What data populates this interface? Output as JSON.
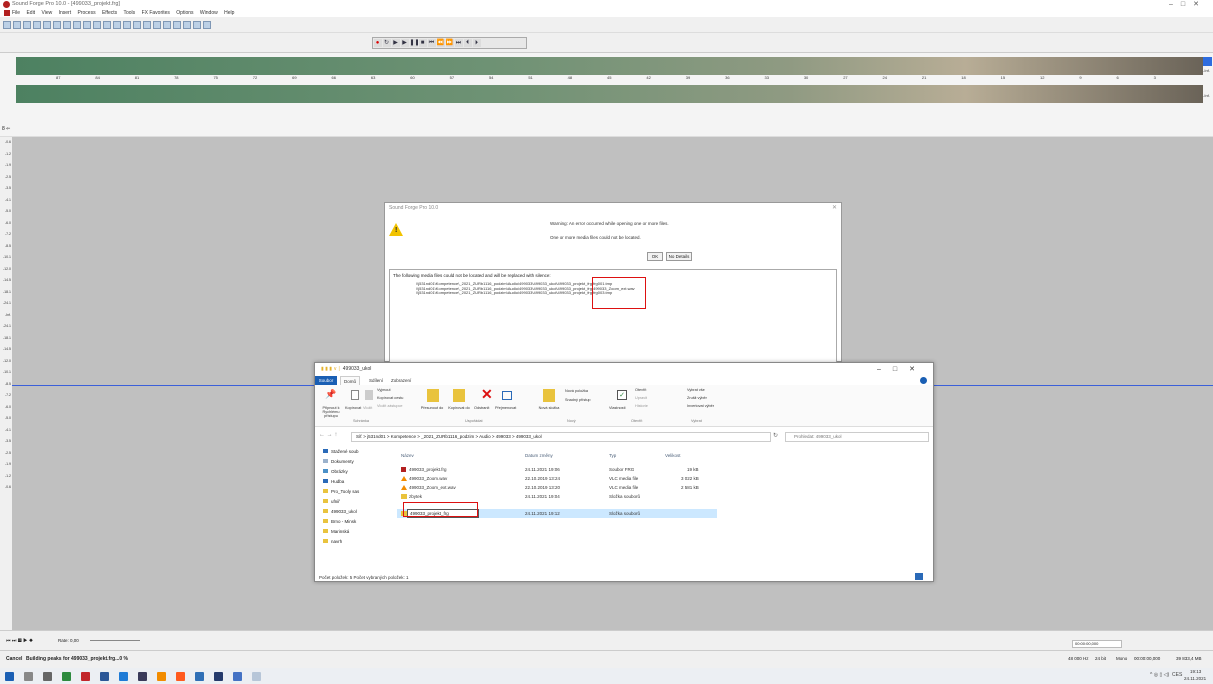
{
  "app": {
    "title": "Sound Forge Pro 10.0 - [499033_projekt.frg]",
    "menu": [
      "File",
      "Edit",
      "View",
      "Insert",
      "Process",
      "Effects",
      "Tools",
      "FX Favorites",
      "Options",
      "Window",
      "Help"
    ],
    "ruler_numbers": [
      "87",
      "84",
      "81",
      "78",
      "75",
      "72",
      "69",
      "66",
      "63",
      "60",
      "57",
      "54",
      "51",
      "48",
      "45",
      "42",
      "39",
      "36",
      "33",
      "30",
      "27",
      "24",
      "21",
      "18",
      "15",
      "12",
      "9",
      "6",
      "3"
    ],
    "db_label_top": "-Inf.",
    "db_label_bottom": "-Inf.",
    "left_ruler": [
      "-0.6",
      "-1.2",
      "-1.9",
      "-2.5",
      "-3.5",
      "-4.1",
      "-5.0",
      "-6.0",
      "-7.2",
      "-8.5",
      "-10.1",
      "-12.0",
      "-14.5",
      "-18.1",
      "-24.1",
      "-Inf.",
      "-24.1",
      "-18.1",
      "-14.5",
      "-12.0",
      "-10.1",
      "-8.5",
      "-7.2",
      "-6.0",
      "-5.0",
      "-4.1",
      "-3.5",
      "-2.5",
      "-1.9",
      "-1.2",
      "-0.6"
    ],
    "rate_label": "Rate: 0,00",
    "status_cancel": "Cancel",
    "status_text": "Building peaks for 499033_projekt.frg...0 %",
    "status_right": [
      "48 000 Hz",
      "24 bit",
      "Mono",
      "00:00:00,000",
      "39 833,4 MB"
    ],
    "time_field": "00:00:00,000",
    "clock_time": "19:13",
    "clock_date": "24.11.2021",
    "tray_lang": "CES"
  },
  "dialog": {
    "title": "Sound Forge Pro 10.0",
    "warning": "Warning: An error occurred while opening one or more files.",
    "detail": "One or more media files could not be located.",
    "ok_label": "OK",
    "details_label": "No Details",
    "list_header": "The following media files could not be located and will be replaced with silence:",
    "paths": [
      "\\\\j531nd01\\Kompetence\\_2021_ZURb1116_podzim\\Audio\\499033\\499033_ukol\\499033_projekt_frg\\frg001.tmp",
      "\\\\j531nd01\\Kompetence\\_2021_ZURb1116_podzim\\Audio\\499033\\499033_ukol\\499033_projekt_frg\\499033_Zoom_ext.wav",
      "\\\\j531nd01\\Kompetence\\_2021_ZURb1116_podzim\\Audio\\499033\\499033_ukol\\499033_projekt_frg\\frg003.tmp"
    ]
  },
  "explorer": {
    "title": "499033_ukol",
    "tabs": [
      "Soubor",
      "Domů",
      "Sdílení",
      "Zobrazení"
    ],
    "ribbon": {
      "pin": "Připnout k Rychlému přístupu",
      "copy": "Kopírovat",
      "paste": "Vložit",
      "cut": "Vyjmout",
      "copy_path": "Kopírovat cestu",
      "paste_shortcut": "Vložit zástupce",
      "group_clipboard": "Schránka",
      "move_to": "Přesunout do",
      "copy_to": "Kopírovat do",
      "delete": "Odstranit",
      "rename": "Přejmenovat",
      "group_organize": "Uspořádat",
      "new_folder": "Nová složka",
      "new_item": "Nová položka",
      "easy_access": "Snadný přístup",
      "group_new": "Nový",
      "properties": "Vlastnosti",
      "open": "Otevřít",
      "edit": "Upravit",
      "history": "Historie",
      "group_open": "Otevřít",
      "select_all": "Vybrat vše",
      "select_none": "Zrušit výběr",
      "invert": "Invertovat výběr",
      "group_select": "Vybrat"
    },
    "address": "Síť  >  j531nd01  >  Kompetence  >  _2021_ZURb1116_podzim  >  Audio  >  499033  >  499033_ukol",
    "search_placeholder": "Prohledat: 499033_ukol",
    "nav": [
      "Stažené soub",
      "Dokumenty",
      "Obrázky",
      "Hudba",
      "Pro_Tooly sas",
      "ufniř",
      "499033_ukol",
      "Brno - Minsk",
      "Marinská",
      "navrh"
    ],
    "columns": [
      "Název",
      "Datum změny",
      "Typ",
      "Velikost"
    ],
    "files": [
      {
        "name": "499033_projekt.frg",
        "date": "24.11.2021 19:06",
        "type": "Soubor FRG",
        "size": "19 kB",
        "color": "#b32020"
      },
      {
        "name": "499033_Zoom.wav",
        "date": "22.10.2019 13:24",
        "type": "VLC media file",
        "size": "3 022 kB",
        "color": "#f28c00"
      },
      {
        "name": "499033_Zoom_ext.wav",
        "date": "22.10.2019 13:20",
        "type": "VLC media file",
        "size": "2 581 kB",
        "color": "#f28c00"
      },
      {
        "name": "zbytek",
        "date": "24.11.2021 19:04",
        "type": "Složka souborů",
        "size": "",
        "color": "#e9c33d"
      },
      {
        "name": "",
        "date": "24.11.2021 19:12",
        "type": "Složka souborů",
        "size": "",
        "color": "#e9c33d"
      }
    ],
    "rename_value": "499033_projekt_frg",
    "status": "Počet položek: 5     Počet vybraných položek: 1"
  }
}
